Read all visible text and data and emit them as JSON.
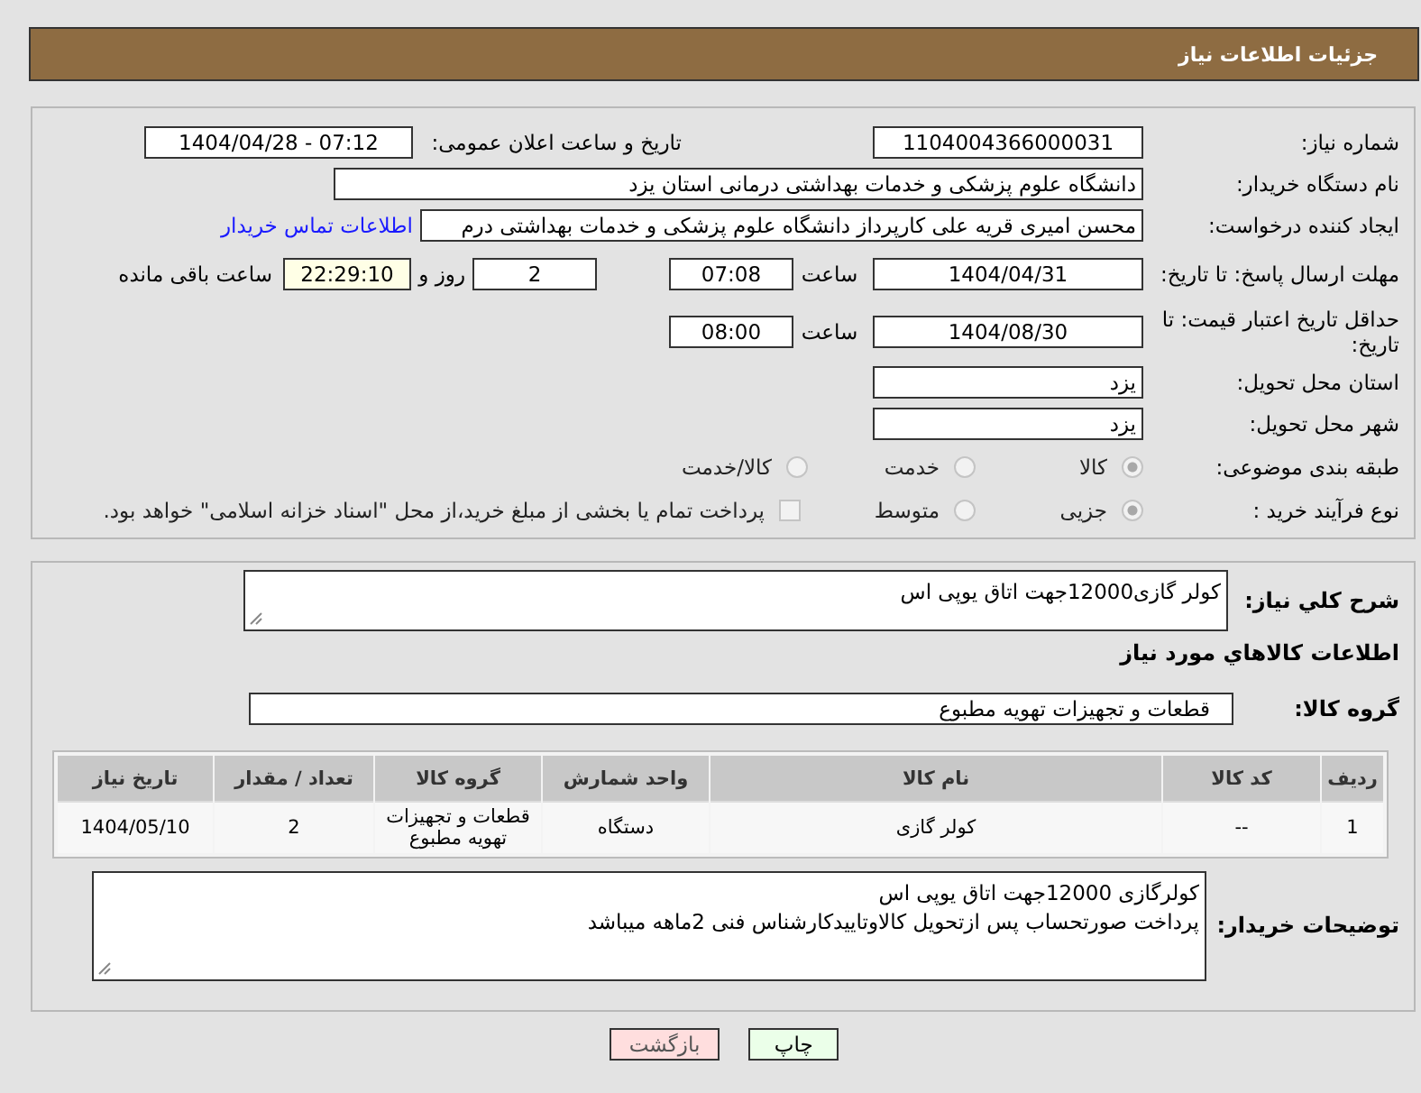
{
  "header": {
    "title": "جزئیات اطلاعات نیاز"
  },
  "info": {
    "need_number": {
      "label": "شماره نیاز:",
      "value": "1104004366000031"
    },
    "announce": {
      "label": "تاریخ و ساعت اعلان عمومی:",
      "value": "1404/04/28 - 07:12"
    },
    "buyer": {
      "label": "نام دستگاه خریدار:",
      "value": "دانشگاه علوم پزشکی و خدمات بهداشتی  درمانی استان یزد"
    },
    "creator": {
      "label": "ایجاد کننده درخواست:",
      "value": "محسن امیری قریه علی کارپرداز دانشگاه علوم پزشکی و خدمات بهداشتی  درم",
      "link": "اطلاعات تماس خریدار"
    },
    "deadline": {
      "label": "مهلت ارسال پاسخ: تا تاریخ:",
      "date": "1404/04/31",
      "time_label": "ساعت",
      "time": "07:08",
      "days": "2",
      "days_label": "روز و",
      "remaining": "22:29:10",
      "remaining_label": "ساعت باقی مانده"
    },
    "validity": {
      "label": "حداقل تاریخ اعتبار قیمت: تا تاریخ:",
      "date": "1404/08/30",
      "time_label": "ساعت",
      "time": "08:00"
    },
    "province": {
      "label": "استان محل تحویل:",
      "value": "یزد"
    },
    "city": {
      "label": "شهر محل تحویل:",
      "value": "یزد"
    },
    "category": {
      "label": "طبقه بندی موضوعی:",
      "options": [
        {
          "label": "کالا",
          "selected": true
        },
        {
          "label": "خدمت",
          "selected": false
        },
        {
          "label": "کالا/خدمت",
          "selected": false
        }
      ]
    },
    "process": {
      "label": "نوع فرآیند خرید :",
      "options": [
        {
          "label": "جزیی",
          "selected": true
        },
        {
          "label": "متوسط",
          "selected": false
        }
      ],
      "treasury": {
        "checked": false,
        "text": "پرداخت تمام یا بخشی از مبلغ خرید،از محل \"اسناد خزانه اسلامی\" خواهد بود."
      }
    }
  },
  "details": {
    "summary": {
      "label": "شرح کلي نياز:",
      "value": "کولر گازی12000جهت اتاق یوپی اس"
    },
    "goods_heading": "اطلاعات کالاهاي مورد نياز",
    "group": {
      "label": "گروه کالا:",
      "value": "قطعات و تجهیزات تهویه مطبوع"
    },
    "table": {
      "columns": [
        "ردیف",
        "کد کالا",
        "نام کالا",
        "واحد شمارش",
        "گروه کالا",
        "تعداد / مقدار",
        "تاریخ نیاز"
      ],
      "rows": [
        [
          "1",
          "--",
          "کولر گازی",
          "دستگاه",
          "قطعات و تجهیزات تهویه مطبوع",
          "2",
          "1404/05/10"
        ]
      ]
    },
    "buyer_notes": {
      "label": "توضیحات خریدار:",
      "value": "کولرگازی 12000جهت اتاق یوپی اس\nپرداخت صورتحساب پس ازتحویل کالاوتاییدکارشناس فنی 2ماهه میباشد"
    }
  },
  "buttons": [
    {
      "kind": "print",
      "label": "چاپ"
    },
    {
      "kind": "back",
      "label": "بازگشت"
    }
  ]
}
